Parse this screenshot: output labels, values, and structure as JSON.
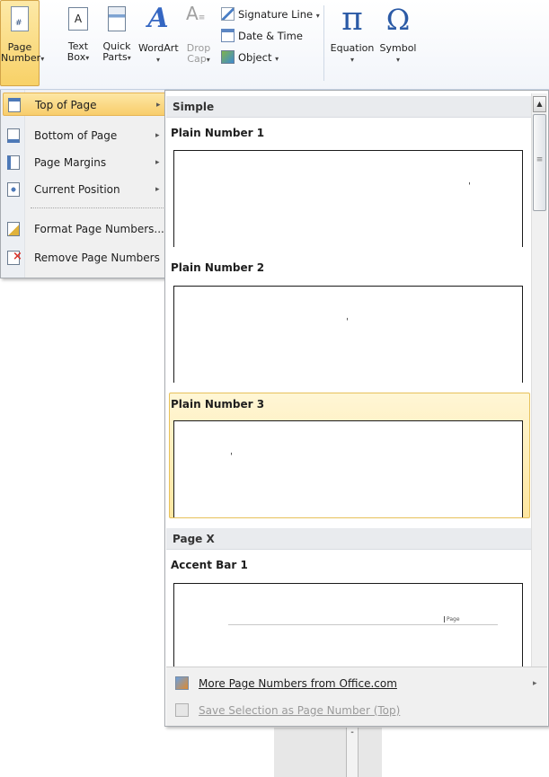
{
  "ribbon": {
    "page_number": {
      "line1": "Page",
      "line2": "Number"
    },
    "text_box": {
      "line1": "Text",
      "line2": "Box"
    },
    "quick_parts": {
      "line1": "Quick",
      "line2": "Parts"
    },
    "wordart": {
      "line1": "WordArt"
    },
    "drop_cap": {
      "line1": "Drop",
      "line2": "Cap"
    },
    "signature_line": "Signature Line",
    "date_time": "Date & Time",
    "object": "Object",
    "equation": "Equation",
    "symbol": "Symbol",
    "dropdown_glyph": "▾",
    "pi_glyph": "π",
    "omega_glyph": "Ω"
  },
  "submenu": {
    "items": [
      {
        "label": "Top of Page",
        "has_submenu": true,
        "selected": true
      },
      {
        "label": "Bottom of Page",
        "has_submenu": true
      },
      {
        "label": "Page Margins",
        "has_submenu": true
      },
      {
        "label": "Current Position",
        "has_submenu": true
      },
      {
        "label": "Format Page Numbers...",
        "has_submenu": false
      },
      {
        "label": "Remove Page Numbers",
        "has_submenu": false
      }
    ],
    "arrow_glyph": "▸"
  },
  "gallery": {
    "section_simple": "Simple",
    "section_page_x": "Page X",
    "items": [
      {
        "title": "Plain Number 1"
      },
      {
        "title": "Plain Number 2"
      },
      {
        "title": "Plain Number 3",
        "highlighted": true
      },
      {
        "title": "Accent Bar 1",
        "preview_text": "Page"
      }
    ],
    "preview_mark": "ˌ",
    "scroll_up": "▲",
    "scroll_down": "▼",
    "footer": {
      "more": "More Page Numbers from Office.com",
      "save": "Save Selection as Page Number (Top)"
    }
  }
}
